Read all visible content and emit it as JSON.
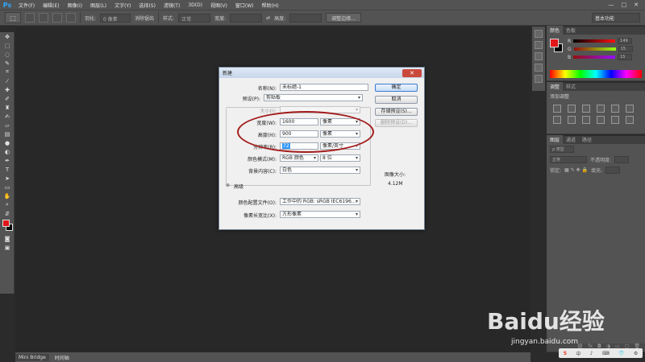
{
  "app": {
    "logo": "Ps"
  },
  "menu": [
    "文件(F)",
    "编辑(E)",
    "图像(I)",
    "图层(L)",
    "文字(Y)",
    "选择(S)",
    "滤镜(T)",
    "3D(D)",
    "视图(V)",
    "窗口(W)",
    "帮助(H)"
  ],
  "window_controls": [
    "—",
    "□",
    "✕"
  ],
  "options": {
    "feather_label": "羽化:",
    "feather_value": "0 像素",
    "antialias_label": "消除锯齿",
    "style_label": "样式:",
    "style_value": "正常",
    "width_label": "宽度:",
    "height_label": "高度:",
    "refine_button": "调整边缘...",
    "workspace": "基本功能"
  },
  "toolbox": {
    "tools": [
      "marquee-icon",
      "lasso-icon",
      "quick-select-icon",
      "crop-icon",
      "eyedropper-icon",
      "healing-icon",
      "brush-icon",
      "stamp-icon",
      "history-brush-icon",
      "eraser-icon",
      "gradient-icon",
      "blur-icon",
      "dodge-icon",
      "pen-icon",
      "type-icon",
      "path-select-icon",
      "shape-icon",
      "hand-icon",
      "zoom-icon"
    ],
    "fg_color": "#e0161a",
    "bg_color": "#000000"
  },
  "bottom_tabs": [
    "Mini Bridge",
    "时间轴"
  ],
  "color_panel": {
    "tabs": [
      "颜色",
      "色板"
    ],
    "channels": [
      {
        "label": "R",
        "value": "149"
      },
      {
        "label": "G",
        "value": "15"
      },
      {
        "label": "B",
        "value": "15"
      }
    ],
    "fg_color": "#e0161a"
  },
  "adjust_panel": {
    "tabs": [
      "调整",
      "样式"
    ],
    "hint": "添加调整"
  },
  "layers_panel": {
    "tabs": [
      "图层",
      "通道",
      "路径"
    ],
    "kind": "ρ 类型",
    "blend": "正常",
    "opacity_label": "不透明度:",
    "lock_label": "锁定:",
    "fill_label": "填充:"
  },
  "dialog": {
    "title": "新建",
    "close": "✕",
    "name_label": "名称(N):",
    "name_value": "未标题-1",
    "preset_label": "预设(P):",
    "preset_value": "剪贴板",
    "size_label": "大小(I):",
    "width_label": "宽度(W):",
    "width_value": "1600",
    "width_unit": "像素",
    "height_label": "高度(H):",
    "height_value": "900",
    "height_unit": "像素",
    "resolution_label": "分辨率(R):",
    "resolution_value": "72",
    "resolution_unit": "像素/英寸",
    "color_mode_label": "颜色模式(M):",
    "color_mode_value": "RGB 颜色",
    "bit_depth": "8 位",
    "bg_label": "背景内容(C):",
    "bg_value": "白色",
    "advanced_label": "高级",
    "advanced_toggle": "⊗",
    "profile_label": "颜色配置文件(O):",
    "profile_value": "工作中的 RGB: sRGB IEC6196...",
    "aspect_label": "像素长宽比(X):",
    "aspect_value": "方形像素",
    "buttons": {
      "ok": "确定",
      "cancel": "取消",
      "save_preset": "存储预设(S)...",
      "delete_preset": "删除预设(D)..."
    },
    "image_size_label": "图像大小:",
    "image_size_value": "4.12M"
  },
  "watermark": {
    "brand": "Baidu经验",
    "url": "jingyan.baidu.com"
  },
  "tray": {
    "items": [
      "S",
      "中",
      "♪",
      "⌨",
      "👕",
      "⚙"
    ]
  }
}
